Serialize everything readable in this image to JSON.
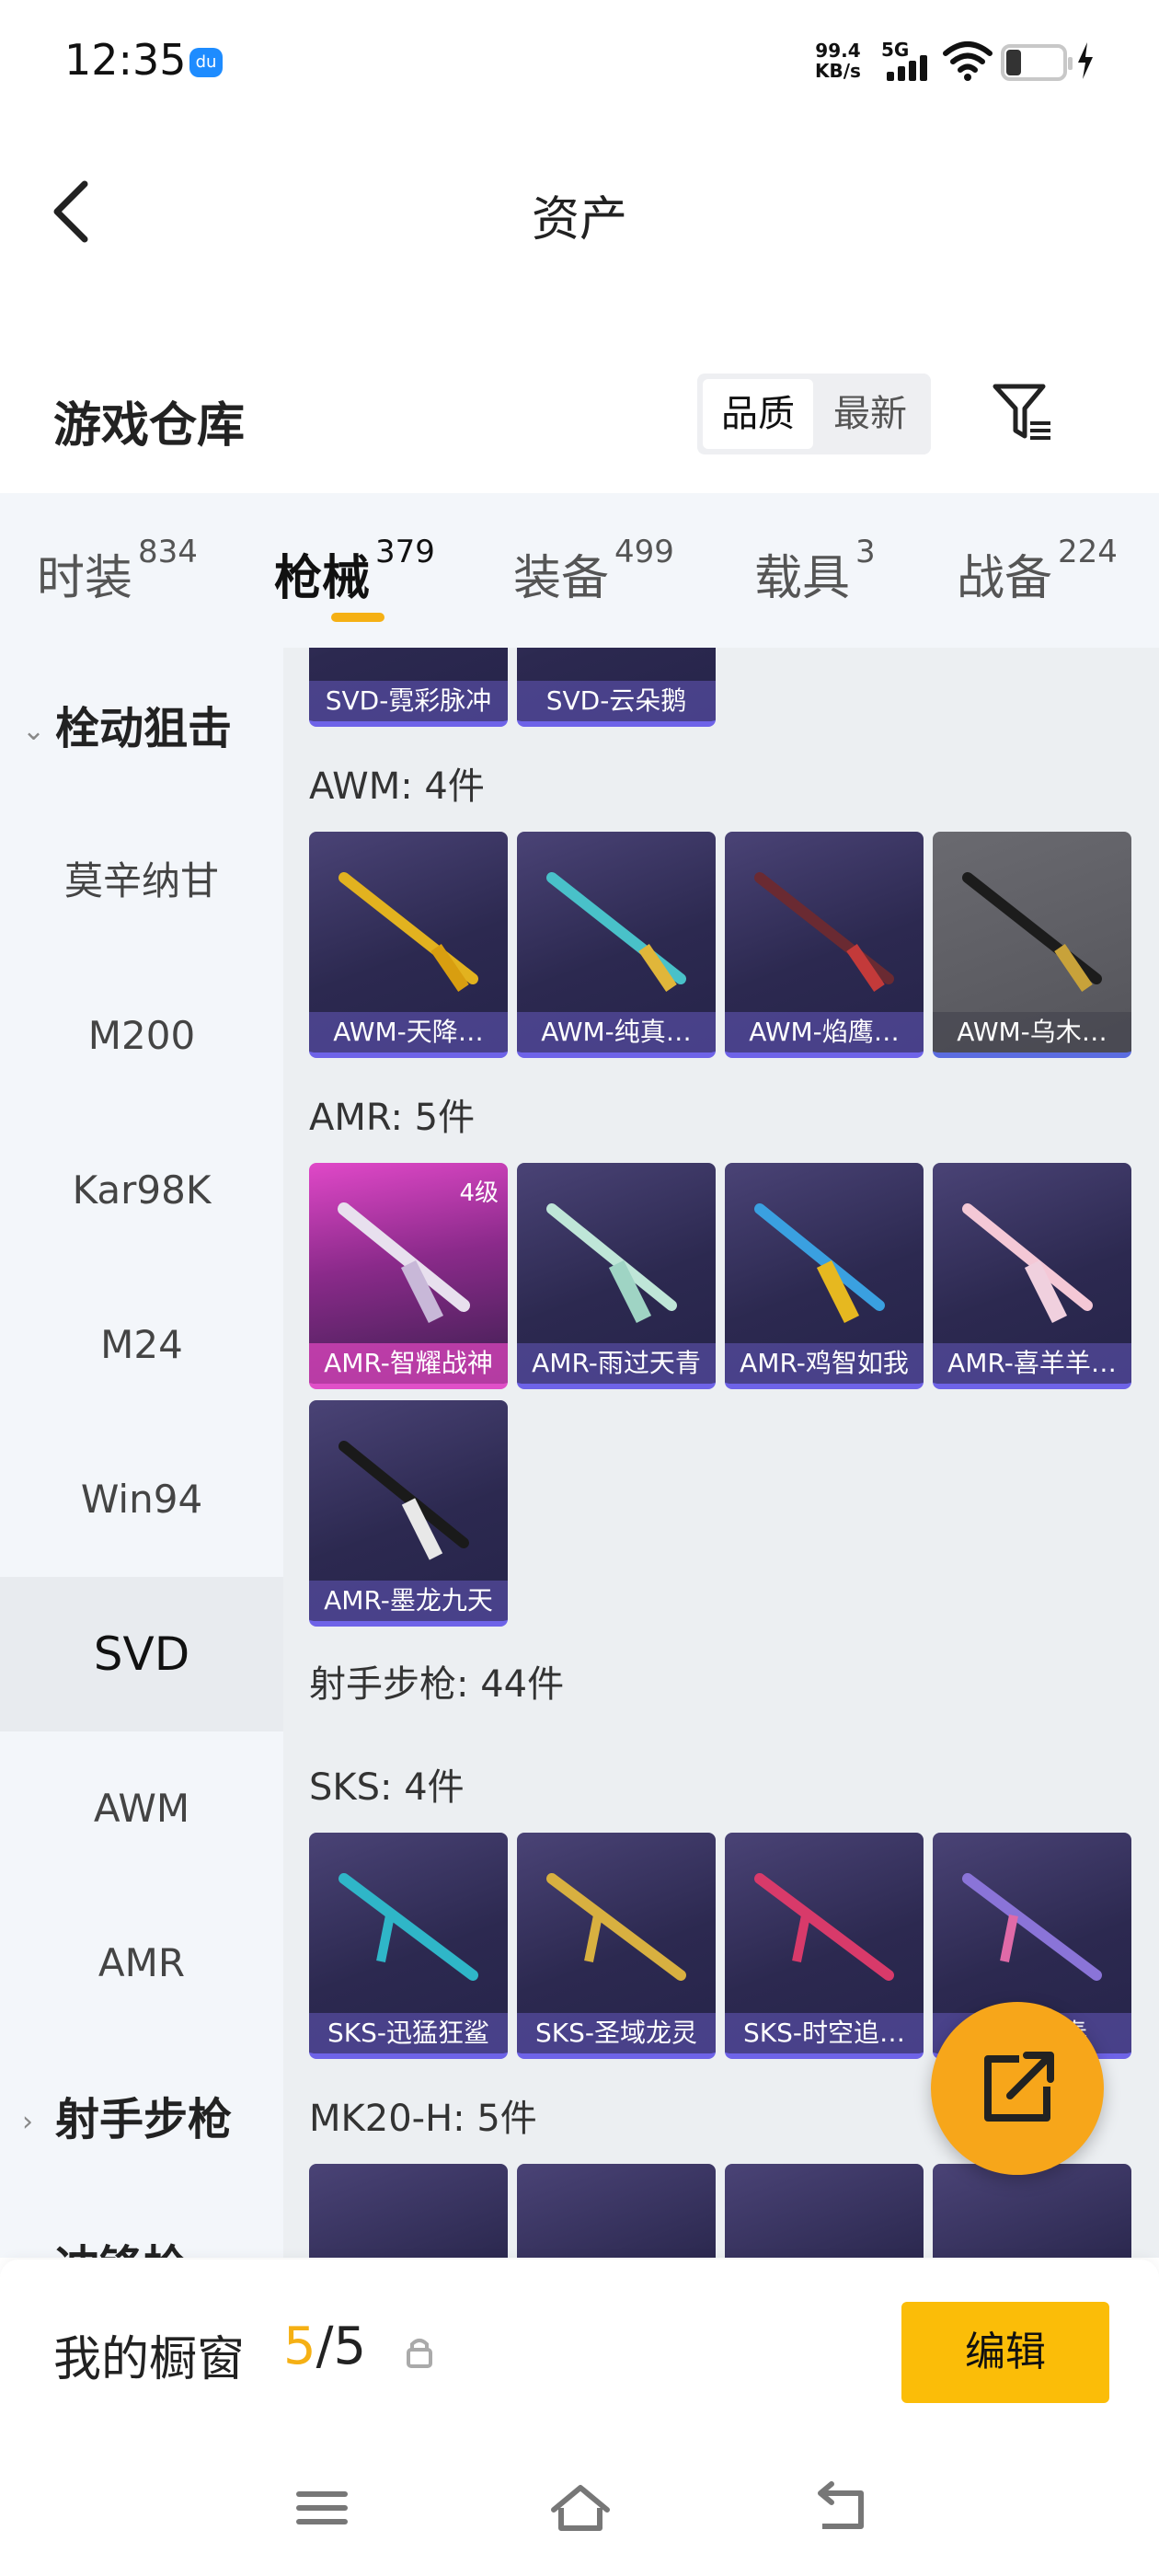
{
  "status_bar": {
    "time": "12:35",
    "app_icon_text": "du",
    "net_speed": "99.4",
    "net_unit": "KB/s",
    "network": "5G"
  },
  "header": {
    "title": "资产"
  },
  "section": {
    "title": "游戏仓库",
    "sort_quality": "品质",
    "sort_latest": "最新"
  },
  "tabs": [
    {
      "label": "时装",
      "count": "834"
    },
    {
      "label": "枪械",
      "count": "379"
    },
    {
      "label": "装备",
      "count": "499"
    },
    {
      "label": "载具",
      "count": "3"
    },
    {
      "label": "战备",
      "count": "224"
    }
  ],
  "sidebar": {
    "group_bolt": "栓动狙击",
    "items": [
      "莫辛纳甘",
      "M200",
      "Kar98K",
      "M24",
      "Win94",
      "SVD",
      "AWM",
      "AMR"
    ],
    "group_marksman": "射手步枪",
    "group_partial": "冲锋枪"
  },
  "content": {
    "top_cards": [
      "SVD-霓彩脉冲",
      "SVD-云朵鹅"
    ],
    "awm_label": "AWM: 4件",
    "awm_cards": [
      "AWM-天降…",
      "AWM-纯真…",
      "AWM-焰鹰…",
      "AWM-乌木…"
    ],
    "amr_label": "AMR: 5件",
    "amr_badge": "4级",
    "amr_cards": [
      "AMR-智耀战神",
      "AMR-雨过天青",
      "AMR-鸡智如我",
      "AMR-喜羊羊…",
      "AMR-墨龙九天"
    ],
    "marksman_label": "射手步枪: 44件",
    "sks_label": "SKS: 4件",
    "sks_cards": [
      "SKS-迅猛狂鲨",
      "SKS-圣域龙灵",
      "SKS-时空追…",
      "SKS-…奏"
    ],
    "mk20_label": "MK20-H: 5件"
  },
  "bottom": {
    "window_label": "我的橱窗",
    "count_current": "5",
    "count_sep": "/",
    "count_total": "5",
    "edit_label": "编辑"
  },
  "colors": {
    "accent": "#f5b014",
    "edit_button": "#fbbd08",
    "fab": "#f7a61a"
  }
}
